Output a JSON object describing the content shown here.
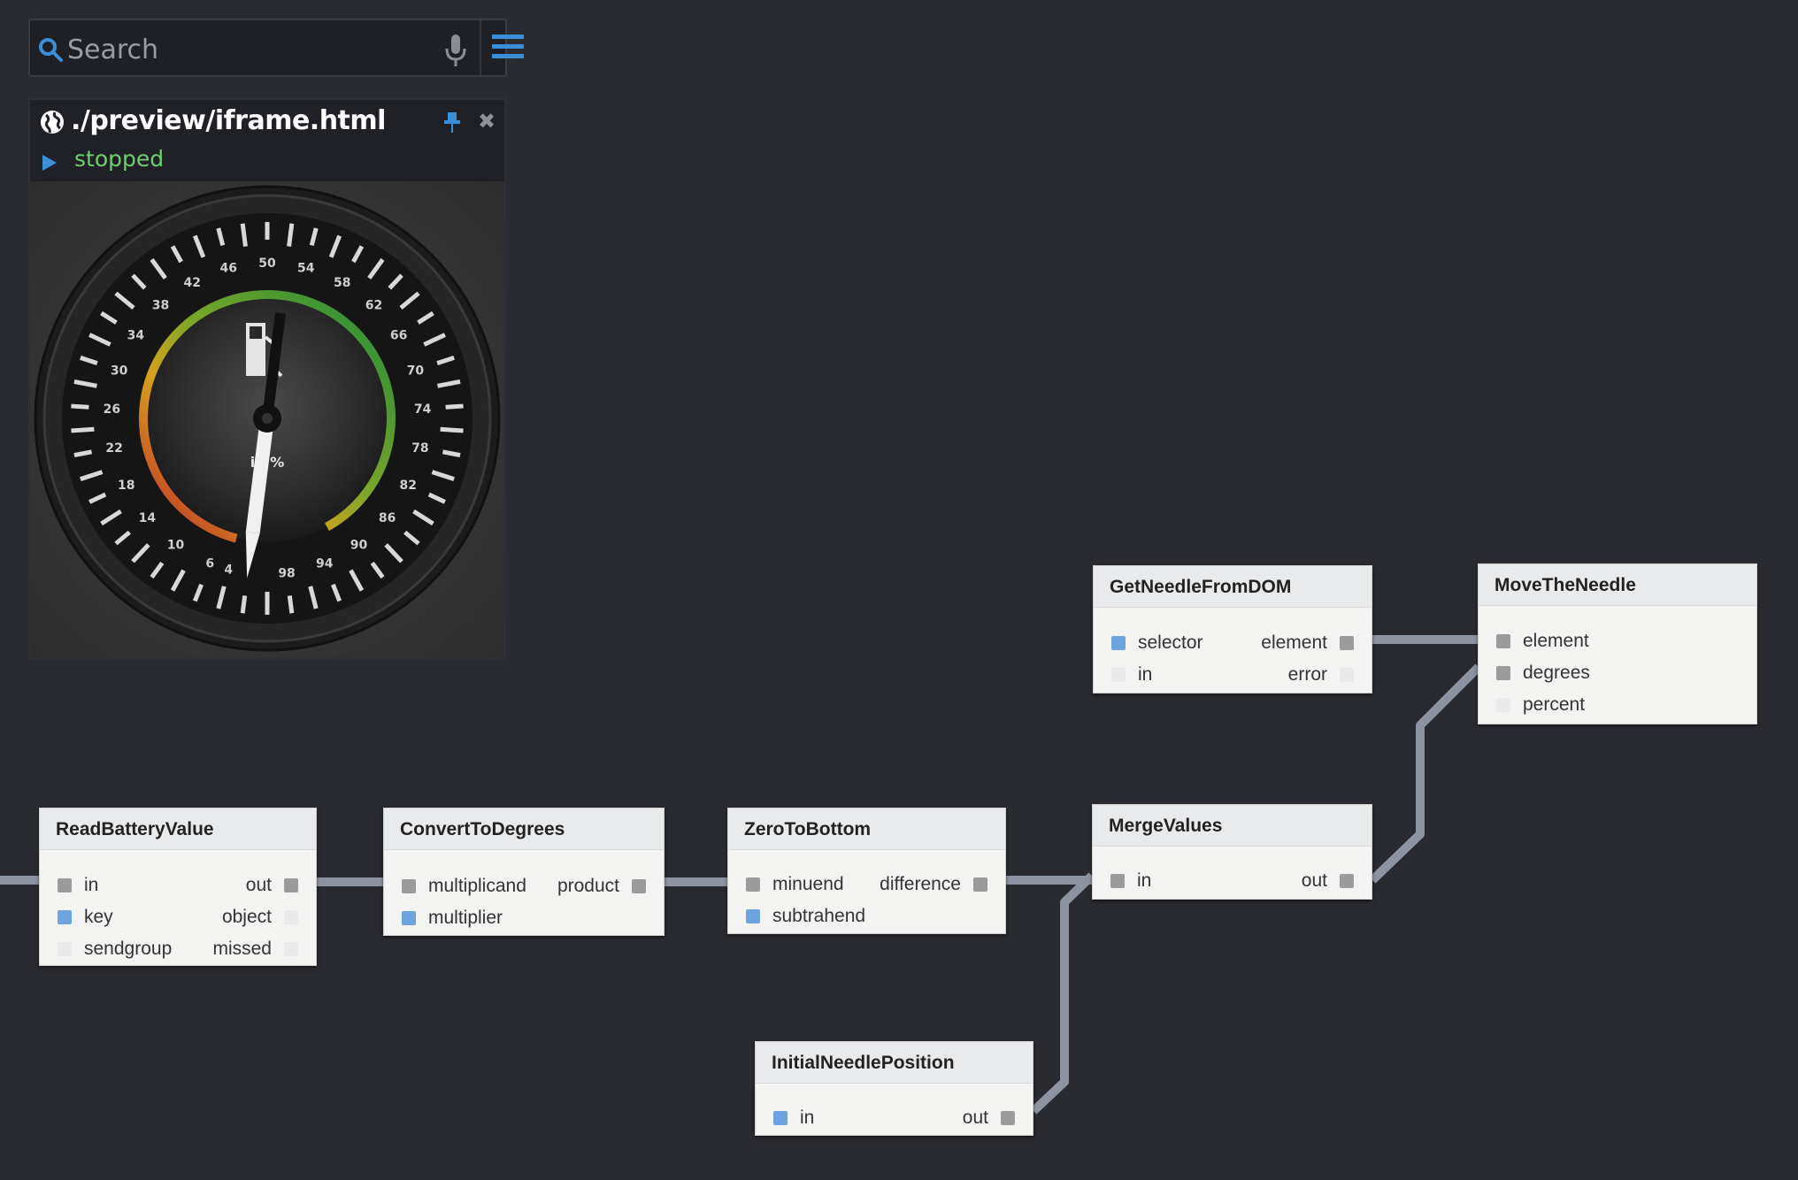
{
  "search": {
    "placeholder": "Search"
  },
  "preview": {
    "url": "./preview/iframe.html",
    "status": "stopped",
    "gauge": {
      "unit_label": "in %",
      "scale_labels": [
        "4",
        "6",
        "10",
        "14",
        "18",
        "22",
        "26",
        "30",
        "34",
        "38",
        "42",
        "46",
        "50",
        "54",
        "58",
        "62",
        "66",
        "70",
        "74",
        "78",
        "82",
        "86",
        "90",
        "94",
        "98"
      ],
      "needle_value": 2
    }
  },
  "nodes": {
    "read_battery": {
      "title": "ReadBatteryValue",
      "in": [
        "in",
        "key",
        "sendgroup"
      ],
      "out": [
        "out",
        "object",
        "missed"
      ]
    },
    "convert": {
      "title": "ConvertToDegrees",
      "in": [
        "multiplicand",
        "multiplier"
      ],
      "out": [
        "product"
      ]
    },
    "zero": {
      "title": "ZeroToBottom",
      "in": [
        "minuend",
        "subtrahend"
      ],
      "out": [
        "difference"
      ]
    },
    "merge": {
      "title": "MergeValues",
      "in": [
        "in"
      ],
      "out": [
        "out"
      ]
    },
    "get_needle": {
      "title": "GetNeedleFromDOM",
      "in": [
        "selector",
        "in"
      ],
      "out": [
        "element",
        "error"
      ]
    },
    "move": {
      "title": "MoveTheNeedle",
      "in": [
        "element",
        "degrees",
        "percent"
      ]
    },
    "initial": {
      "title": "InitialNeedlePosition",
      "in": [
        "in"
      ],
      "out": [
        "out"
      ]
    }
  },
  "colors": {
    "background": "#2a2b30",
    "accent": "#3b8fd8",
    "status_running_text": "#6fce6f",
    "wire": "#8d93a0",
    "port_connected": "#9a9b9d",
    "port_iip": "#6da4e0"
  }
}
